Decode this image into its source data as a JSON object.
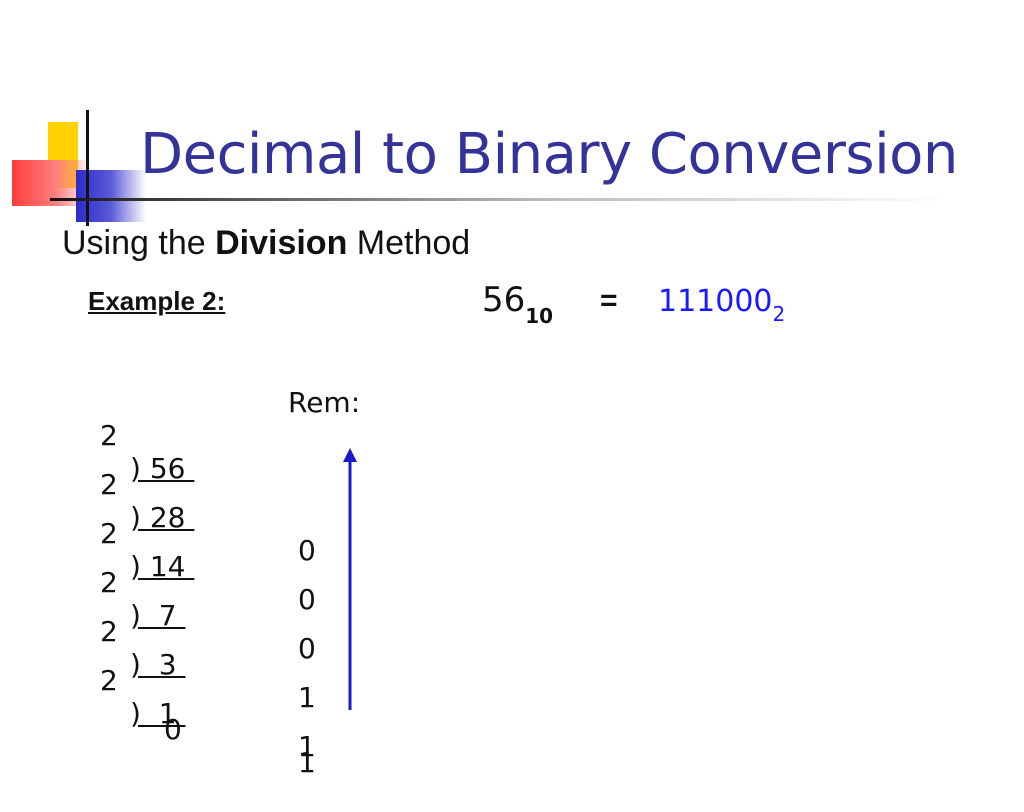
{
  "slide": {
    "title": "Decimal to Binary Conversion",
    "subtitle_prefix": "Using the ",
    "subtitle_bold": "Division",
    "subtitle_suffix": " Method",
    "example_label": "Example 2:",
    "equation": {
      "decimal": "56",
      "decimal_base": "10",
      "equals": "=",
      "binary": "111000",
      "binary_base": "2"
    },
    "rem_header": "Rem:",
    "rows": [
      {
        "divisor": "2",
        "dividend": ") 56 ",
        "remainder": ""
      },
      {
        "divisor": "2",
        "dividend": ") 28 ",
        "remainder": "0"
      },
      {
        "divisor": "2",
        "dividend": ") 14 ",
        "remainder": "0"
      },
      {
        "divisor": "2",
        "dividend": ")  7 ",
        "remainder": "0"
      },
      {
        "divisor": "2",
        "dividend": ")  3 ",
        "remainder": "1"
      },
      {
        "divisor": "2",
        "dividend": ")  1 ",
        "remainder": "1"
      }
    ],
    "final_row": {
      "quotient": "0",
      "remainder": "1"
    },
    "colors": {
      "title": "#33339a",
      "binary": "#1a1aff",
      "arrow": "#1a1acc"
    }
  }
}
